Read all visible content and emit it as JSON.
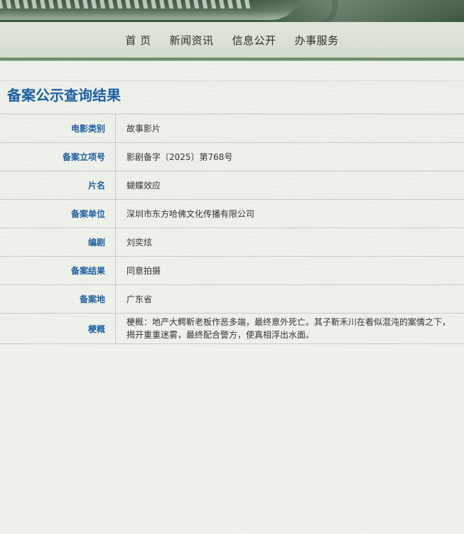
{
  "nav": {
    "items": [
      "首 页",
      "新闻资讯",
      "信息公开",
      "办事服务"
    ]
  },
  "main": {
    "title": "备案公示查询结果",
    "rows": [
      {
        "label": "电影类别",
        "value": "故事影片"
      },
      {
        "label": "备案立项号",
        "value": "影剧备字〔2025〕第768号"
      },
      {
        "label": "片名",
        "value": "蝴蝶效应"
      },
      {
        "label": "备案单位",
        "value": "深圳市东方哈佛文化传播有限公司"
      },
      {
        "label": "编剧",
        "value": "刘奕炫"
      },
      {
        "label": "备案结果",
        "value": "同意拍摄"
      },
      {
        "label": "备案地",
        "value": "广东省"
      },
      {
        "label": "梗概",
        "value": "梗概：地产大鳄靳老板作恶多端，最终意外死亡。其子靳禾川在看似混沌的案情之下，揭开重重迷雾，最终配合警方，使真相浮出水面。"
      }
    ]
  },
  "colors": {
    "accent": "#1d5fa0",
    "nav_border": "#6f8a70",
    "banner": "#3e5642"
  }
}
